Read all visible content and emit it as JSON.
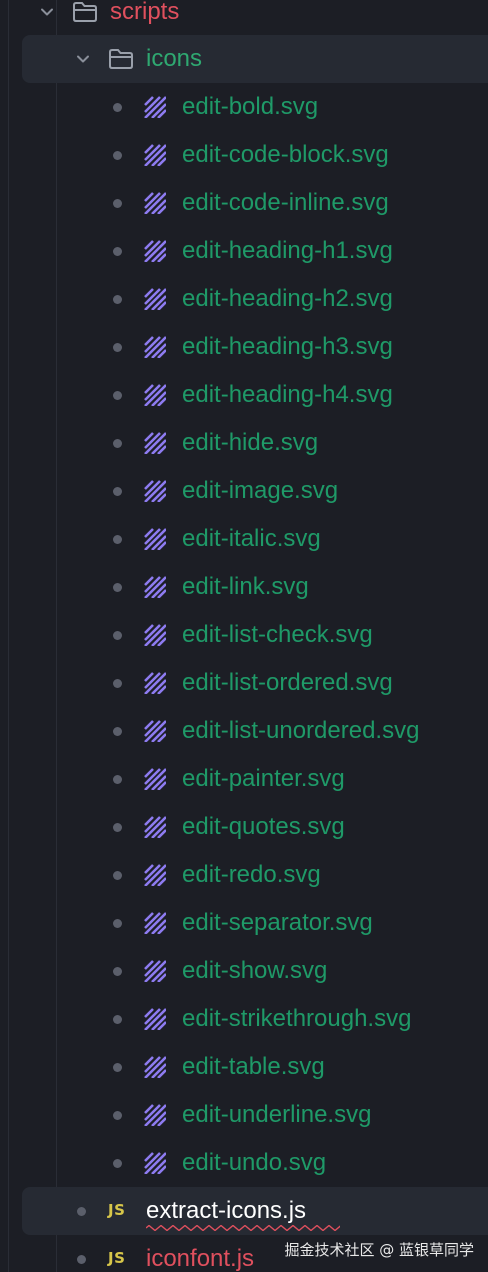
{
  "colors": {
    "background": "#1c1e25",
    "selected_row": "#262a33",
    "folder_label_red": "#e0505e",
    "folder_label_green": "#2fa871",
    "file_label_green": "#1f9a68",
    "svg_icon_purple": "#8d7bf0",
    "js_badge_yellow": "#d7c64a",
    "error_squiggle": "#e0505e"
  },
  "tree": {
    "scripts_folder": {
      "label": "scripts",
      "icon": "folder-icon",
      "expanded": true
    },
    "icons_folder": {
      "label": "icons",
      "icon": "folder-icon",
      "expanded": true
    },
    "svg_files": [
      {
        "label": "edit-bold.svg"
      },
      {
        "label": "edit-code-block.svg"
      },
      {
        "label": "edit-code-inline.svg"
      },
      {
        "label": "edit-heading-h1.svg"
      },
      {
        "label": "edit-heading-h2.svg"
      },
      {
        "label": "edit-heading-h3.svg"
      },
      {
        "label": "edit-heading-h4.svg"
      },
      {
        "label": "edit-hide.svg"
      },
      {
        "label": "edit-image.svg"
      },
      {
        "label": "edit-italic.svg"
      },
      {
        "label": "edit-link.svg"
      },
      {
        "label": "edit-list-check.svg"
      },
      {
        "label": "edit-list-ordered.svg"
      },
      {
        "label": "edit-list-unordered.svg"
      },
      {
        "label": "edit-painter.svg"
      },
      {
        "label": "edit-quotes.svg"
      },
      {
        "label": "edit-redo.svg"
      },
      {
        "label": "edit-separator.svg"
      },
      {
        "label": "edit-show.svg"
      },
      {
        "label": "edit-strikethrough.svg"
      },
      {
        "label": "edit-table.svg"
      },
      {
        "label": "edit-underline.svg"
      },
      {
        "label": "edit-undo.svg"
      }
    ],
    "js_files": [
      {
        "badge": "JS",
        "label": "extract-icons.js",
        "has_error": true,
        "selected": true
      },
      {
        "badge": "JS",
        "label": "iconfont.js",
        "has_error": false,
        "selected": false
      }
    ]
  },
  "watermark": "掘金技术社区 @ 蓝银草同学"
}
